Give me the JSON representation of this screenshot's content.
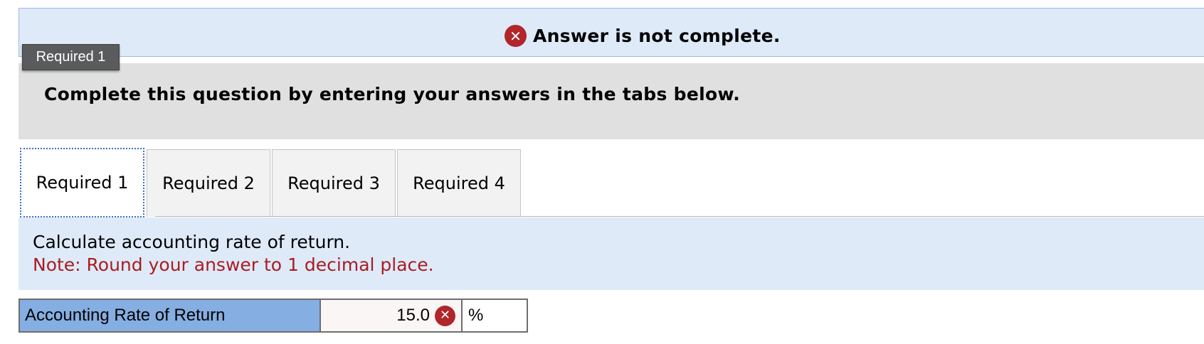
{
  "banner": {
    "icon": "error-x-icon",
    "text": "Answer is not complete."
  },
  "tooltip": {
    "text": "Required 1"
  },
  "instruction": {
    "text": "Complete this question by entering your answers in the tabs below."
  },
  "tabs": [
    {
      "label": "Required 1",
      "active": true
    },
    {
      "label": "Required 2",
      "active": false
    },
    {
      "label": "Required 3",
      "active": false
    },
    {
      "label": "Required 4",
      "active": false
    }
  ],
  "prompt": {
    "question": "Calculate accounting rate of return.",
    "note": "Note: Round your answer to 1 decimal place."
  },
  "answer": {
    "label": "Accounting Rate of Return",
    "value": "15.0",
    "status_icon": "error-x-icon",
    "unit": "%"
  },
  "colors": {
    "error_red": "#b0262b",
    "note_red": "#a81d21",
    "banner_blue": "#deeaf8",
    "label_blue": "#85aee2",
    "active_tab_focus": "#3d6fc0"
  }
}
